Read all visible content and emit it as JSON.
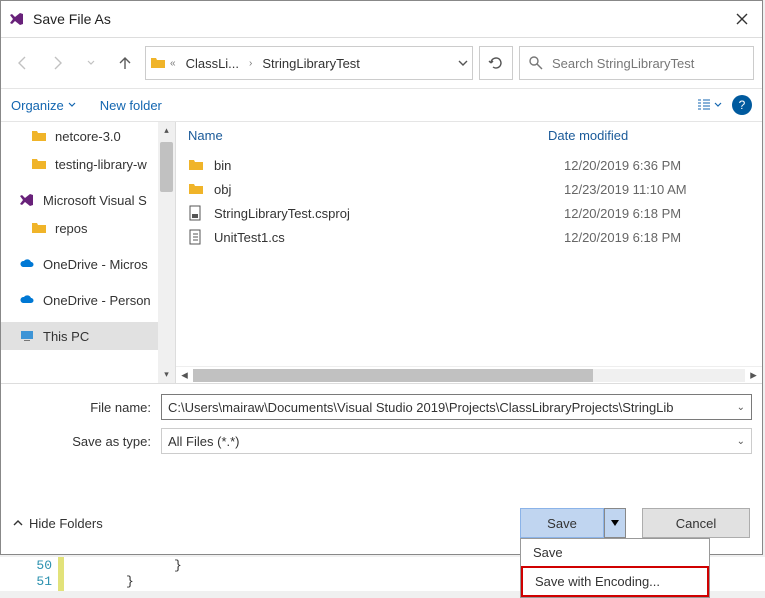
{
  "title": "Save File As",
  "path": {
    "seg1": "ClassLi...",
    "seg2": "StringLibraryTest"
  },
  "search_placeholder": "Search StringLibraryTest",
  "toolbar": {
    "organize": "Organize",
    "new_folder": "New folder"
  },
  "sidebar": {
    "items": [
      {
        "label": "netcore-3.0",
        "type": "folder"
      },
      {
        "label": "testing-library-w",
        "type": "folder"
      },
      {
        "label": "Microsoft Visual S",
        "type": "vs"
      },
      {
        "label": "repos",
        "type": "folder"
      },
      {
        "label": "OneDrive - Micros",
        "type": "cloud"
      },
      {
        "label": "OneDrive - Person",
        "type": "cloud"
      },
      {
        "label": "This PC",
        "type": "pc",
        "selected": true
      }
    ]
  },
  "columns": {
    "name": "Name",
    "date": "Date modified"
  },
  "files": [
    {
      "name": "bin",
      "date": "12/20/2019 6:36 PM",
      "type": "folder"
    },
    {
      "name": "obj",
      "date": "12/23/2019 11:10 AM",
      "type": "folder"
    },
    {
      "name": "StringLibraryTest.csproj",
      "date": "12/20/2019 6:18 PM",
      "type": "csproj"
    },
    {
      "name": "UnitTest1.cs",
      "date": "12/20/2019 6:18 PM",
      "type": "cs"
    }
  ],
  "file_name_label": "File name:",
  "file_name_value": "C:\\Users\\mairaw\\Documents\\Visual Studio 2019\\Projects\\ClassLibraryProjects\\StringLib",
  "save_type_label": "Save as type:",
  "save_type_value": "All Files (*.*)",
  "hide_folders": "Hide Folders",
  "buttons": {
    "save": "Save",
    "cancel": "Cancel"
  },
  "save_menu": {
    "save": "Save",
    "save_enc": "Save with Encoding..."
  },
  "editor": {
    "ln1": "50",
    "ln2": "51",
    "code1": "}",
    "code2": "}"
  }
}
